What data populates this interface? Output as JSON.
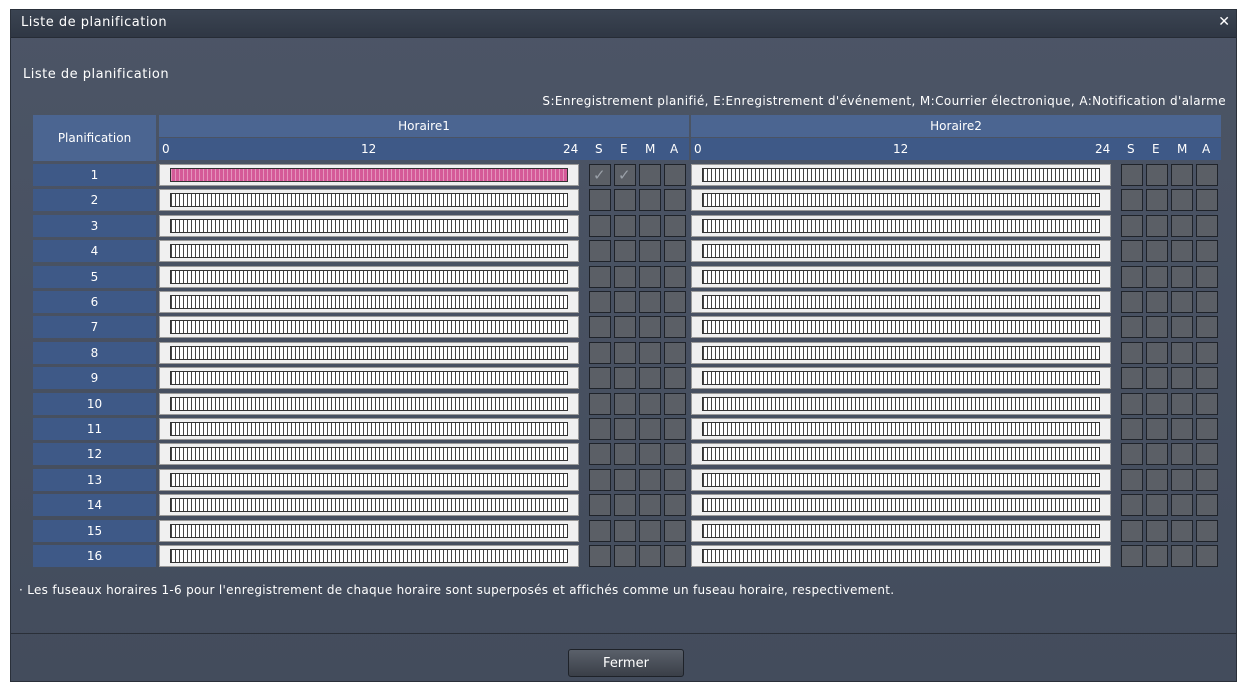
{
  "window": {
    "title": "Liste de planification",
    "close_glyph": "✕"
  },
  "subtitle": "Liste de planification",
  "legend": "S:Enregistrement planifié, E:Enregistrement d'événement, M:Courrier électronique, A:Notification d'alarme",
  "table": {
    "planification_header": "Planification",
    "schedules": [
      {
        "title": "Horaire1",
        "ticks": [
          "0",
          "12",
          "24"
        ],
        "flags": [
          "S",
          "E",
          "M",
          "A"
        ]
      },
      {
        "title": "Horaire2",
        "ticks": [
          "0",
          "12",
          "24"
        ],
        "flags": [
          "S",
          "E",
          "M",
          "A"
        ]
      }
    ],
    "rows": [
      {
        "label": "1",
        "h1_active": true,
        "h1_checks": [
          true,
          true,
          false,
          false
        ],
        "h2_active": false,
        "h2_checks": [
          false,
          false,
          false,
          false
        ]
      },
      {
        "label": "2",
        "h1_active": false,
        "h1_checks": [
          false,
          false,
          false,
          false
        ],
        "h2_active": false,
        "h2_checks": [
          false,
          false,
          false,
          false
        ]
      },
      {
        "label": "3",
        "h1_active": false,
        "h1_checks": [
          false,
          false,
          false,
          false
        ],
        "h2_active": false,
        "h2_checks": [
          false,
          false,
          false,
          false
        ]
      },
      {
        "label": "4",
        "h1_active": false,
        "h1_checks": [
          false,
          false,
          false,
          false
        ],
        "h2_active": false,
        "h2_checks": [
          false,
          false,
          false,
          false
        ]
      },
      {
        "label": "5",
        "h1_active": false,
        "h1_checks": [
          false,
          false,
          false,
          false
        ],
        "h2_active": false,
        "h2_checks": [
          false,
          false,
          false,
          false
        ]
      },
      {
        "label": "6",
        "h1_active": false,
        "h1_checks": [
          false,
          false,
          false,
          false
        ],
        "h2_active": false,
        "h2_checks": [
          false,
          false,
          false,
          false
        ]
      },
      {
        "label": "7",
        "h1_active": false,
        "h1_checks": [
          false,
          false,
          false,
          false
        ],
        "h2_active": false,
        "h2_checks": [
          false,
          false,
          false,
          false
        ]
      },
      {
        "label": "8",
        "h1_active": false,
        "h1_checks": [
          false,
          false,
          false,
          false
        ],
        "h2_active": false,
        "h2_checks": [
          false,
          false,
          false,
          false
        ]
      },
      {
        "label": "9",
        "h1_active": false,
        "h1_checks": [
          false,
          false,
          false,
          false
        ],
        "h2_active": false,
        "h2_checks": [
          false,
          false,
          false,
          false
        ]
      },
      {
        "label": "10",
        "h1_active": false,
        "h1_checks": [
          false,
          false,
          false,
          false
        ],
        "h2_active": false,
        "h2_checks": [
          false,
          false,
          false,
          false
        ]
      },
      {
        "label": "11",
        "h1_active": false,
        "h1_checks": [
          false,
          false,
          false,
          false
        ],
        "h2_active": false,
        "h2_checks": [
          false,
          false,
          false,
          false
        ]
      },
      {
        "label": "12",
        "h1_active": false,
        "h1_checks": [
          false,
          false,
          false,
          false
        ],
        "h2_active": false,
        "h2_checks": [
          false,
          false,
          false,
          false
        ]
      },
      {
        "label": "13",
        "h1_active": false,
        "h1_checks": [
          false,
          false,
          false,
          false
        ],
        "h2_active": false,
        "h2_checks": [
          false,
          false,
          false,
          false
        ]
      },
      {
        "label": "14",
        "h1_active": false,
        "h1_checks": [
          false,
          false,
          false,
          false
        ],
        "h2_active": false,
        "h2_checks": [
          false,
          false,
          false,
          false
        ]
      },
      {
        "label": "15",
        "h1_active": false,
        "h1_checks": [
          false,
          false,
          false,
          false
        ],
        "h2_active": false,
        "h2_checks": [
          false,
          false,
          false,
          false
        ]
      },
      {
        "label": "16",
        "h1_active": false,
        "h1_checks": [
          false,
          false,
          false,
          false
        ],
        "h2_active": false,
        "h2_checks": [
          false,
          false,
          false,
          false
        ]
      }
    ]
  },
  "note": "· Les fuseaux horaires 1-6 pour l'enregistrement de chaque horaire sont superposés et affichés comme un fuseau horaire, respectivement.",
  "buttons": {
    "close_label": "Fermer"
  },
  "colors": {
    "window_bg": "#4a5262",
    "header_blue": "#4b6591",
    "active_bar": "#d55a98"
  }
}
